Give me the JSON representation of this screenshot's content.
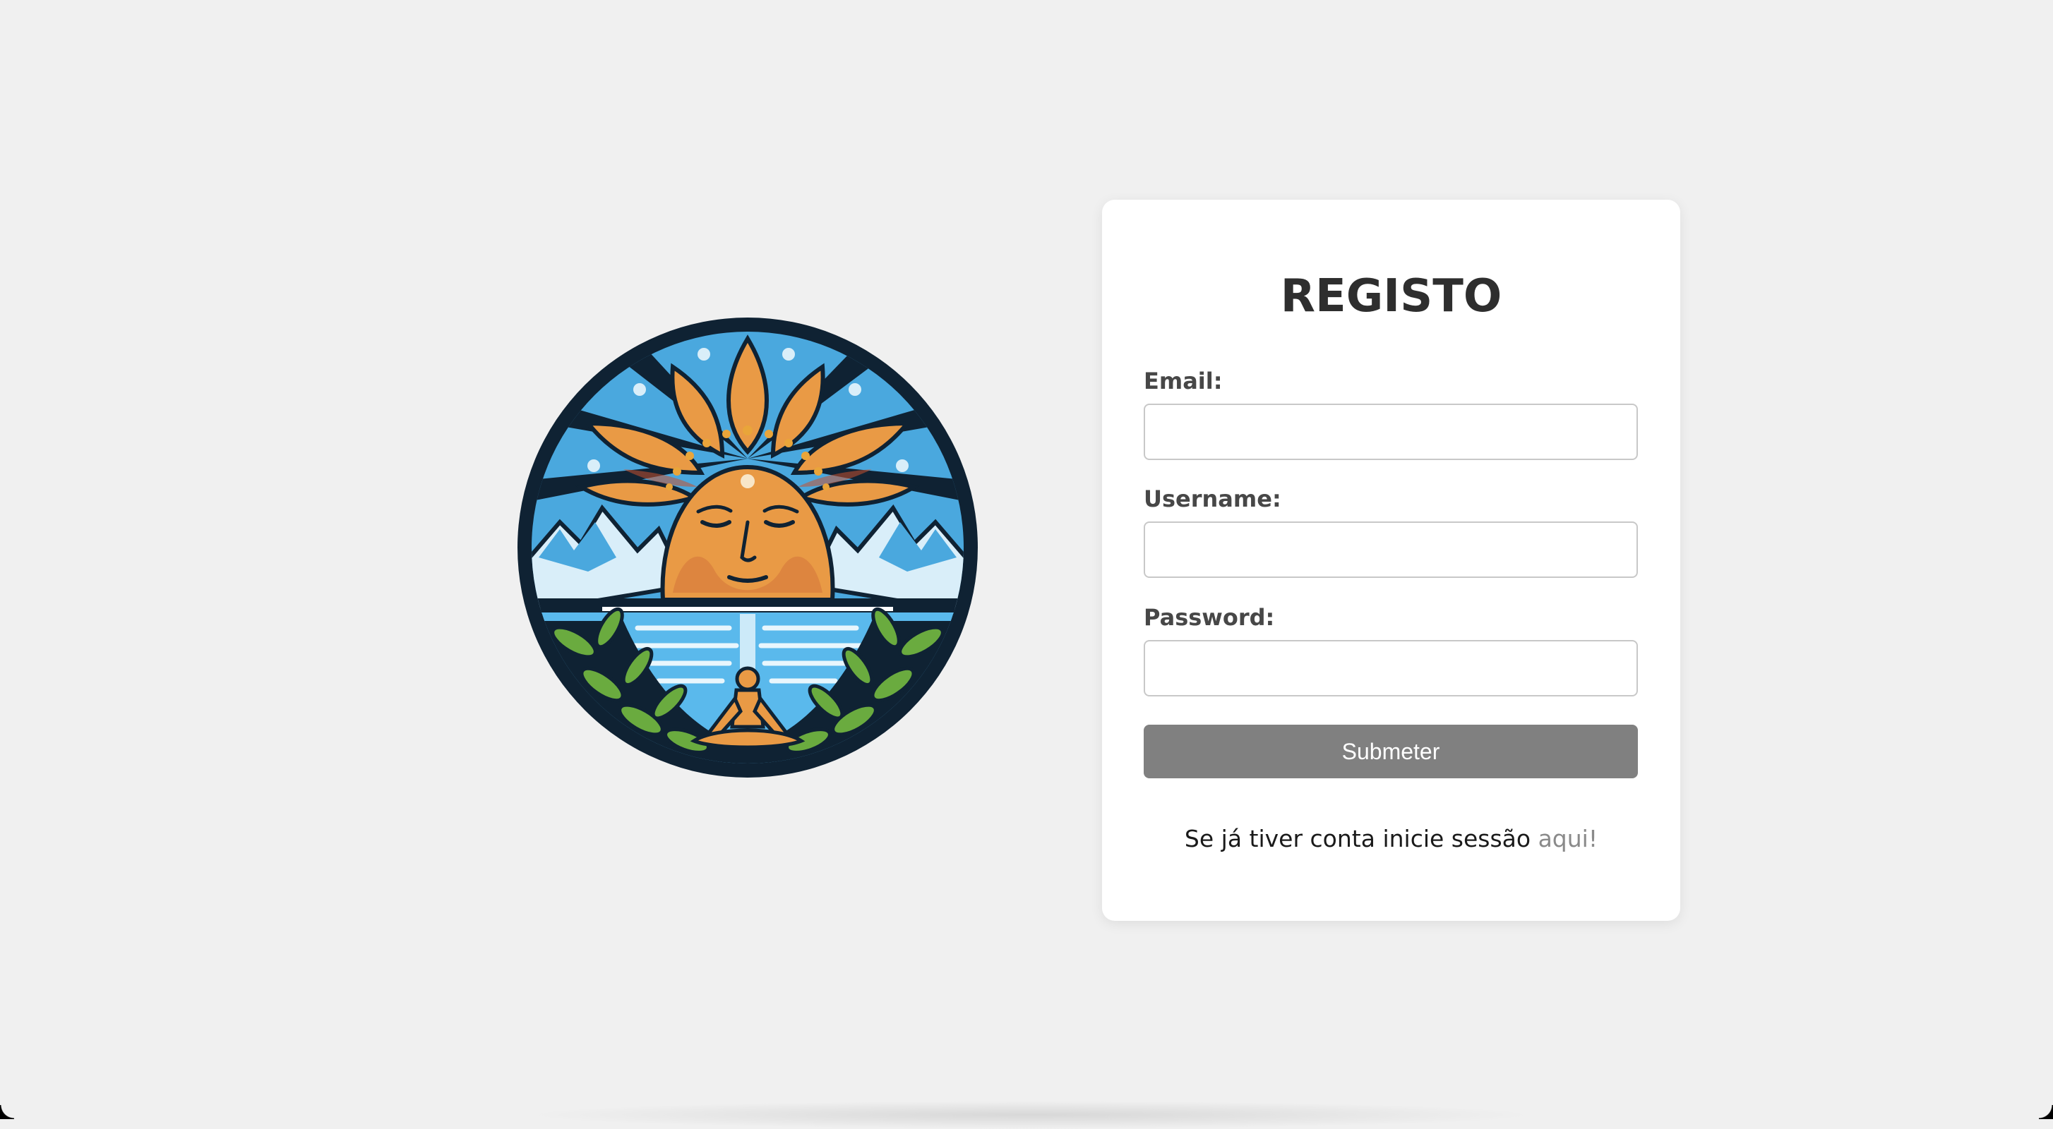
{
  "logo": {
    "icon": "meditation-sun-emblem-icon",
    "colors": {
      "ring": "#0f2233",
      "sky": "#4aa8de",
      "sun": "#e99a45",
      "water": "#5ab9ec",
      "leaves": "#6aab3f"
    }
  },
  "register_form": {
    "title": "REGISTO",
    "email_label": "Email:",
    "email_value": "",
    "username_label": "Username:",
    "username_value": "",
    "password_label": "Password:",
    "password_value": "",
    "submit_label": "Submeter",
    "login_prompt": "Se já tiver conta inicie sessão ",
    "login_link": "aqui!"
  },
  "colors": {
    "page_background": "#f0f0f0",
    "card_background": "#ffffff",
    "button_background": "#808080",
    "link": "#8a8a8a"
  }
}
